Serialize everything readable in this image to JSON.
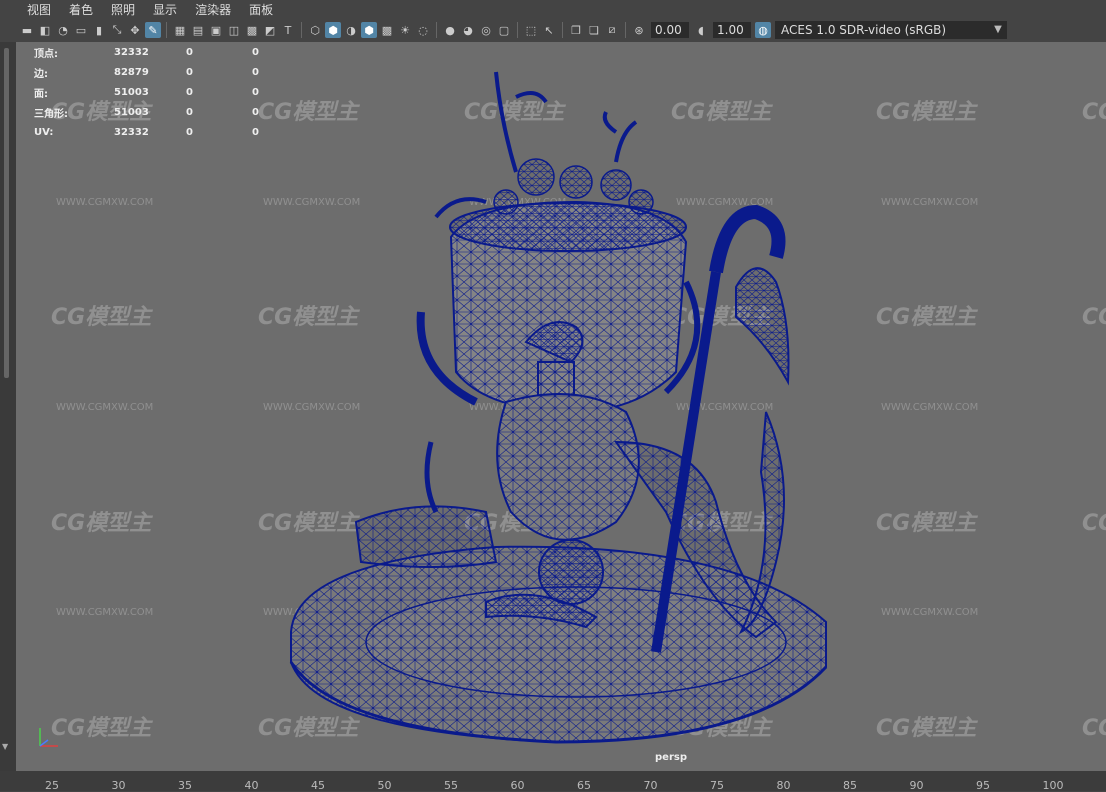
{
  "menu": [
    "视图",
    "着色",
    "照明",
    "显示",
    "渲染器",
    "面板"
  ],
  "toolbar": {
    "exposure": "0.00",
    "gamma": "1.00",
    "color_space": "ACES 1.0 SDR-video (sRGB)"
  },
  "hud": {
    "rows": [
      {
        "label": "顶点:",
        "v1": "32332",
        "v2": "0",
        "v3": "0"
      },
      {
        "label": "边:",
        "v1": "82879",
        "v2": "0",
        "v3": "0"
      },
      {
        "label": "面:",
        "v1": "51003",
        "v2": "0",
        "v3": "0"
      },
      {
        "label": "三角形:",
        "v1": "51003",
        "v2": "0",
        "v3": "0"
      },
      {
        "label": "UV:",
        "v1": "32332",
        "v2": "0",
        "v3": "0"
      }
    ]
  },
  "camera_label": "persp",
  "watermark": {
    "logo": "CG模型主",
    "url": "WWW.CGMXW.COM"
  },
  "timeline_ticks": [
    "25",
    "30",
    "35",
    "40",
    "45",
    "50",
    "55",
    "60",
    "65",
    "70",
    "75",
    "80",
    "85",
    "90",
    "95",
    "100"
  ],
  "wire_color": "#0a1a8c",
  "viewport_bg": "#6d6d6d"
}
